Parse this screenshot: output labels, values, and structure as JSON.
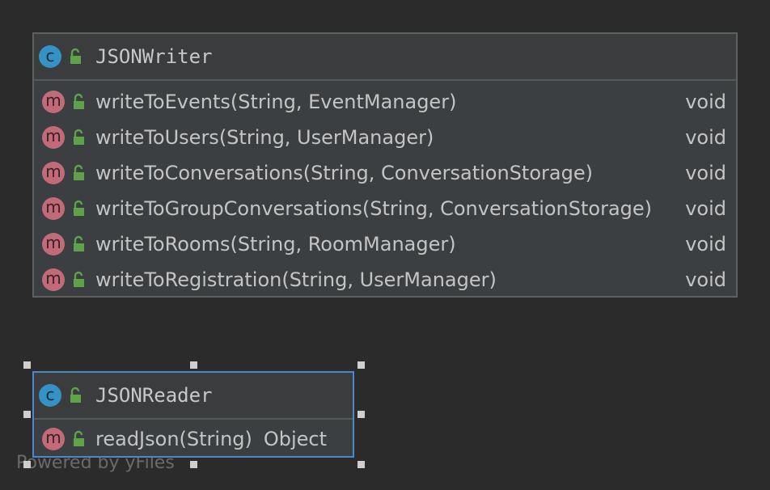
{
  "classes": [
    {
      "name": "JSONWriter",
      "kind_icon": "class-icon",
      "kind_letter": "c",
      "methods": [
        {
          "signature": "writeToEvents(String, EventManager)",
          "return_type": "void"
        },
        {
          "signature": "writeToUsers(String, UserManager)",
          "return_type": "void"
        },
        {
          "signature": "writeToConversations(String, ConversationStorage)",
          "return_type": "void"
        },
        {
          "signature": "writeToGroupConversations(String, ConversationStorage)",
          "return_type": "void"
        },
        {
          "signature": "writeToRooms(String, RoomManager)",
          "return_type": "void"
        },
        {
          "signature": "writeToRegistration(String, UserManager)",
          "return_type": "void"
        }
      ]
    },
    {
      "name": "JSONReader",
      "kind_icon": "class-icon",
      "kind_letter": "c",
      "selected": true,
      "methods": [
        {
          "signature": "readJson(String)",
          "return_type": "Object"
        }
      ]
    }
  ],
  "method_letter": "m",
  "watermark": "Powered by yFiles",
  "colors": {
    "background": "#2b2b2b",
    "class_icon": "#3592c4",
    "method_icon": "#c16a78",
    "public_lock": "#5ea34a",
    "selection_border": "#4a88c7"
  }
}
